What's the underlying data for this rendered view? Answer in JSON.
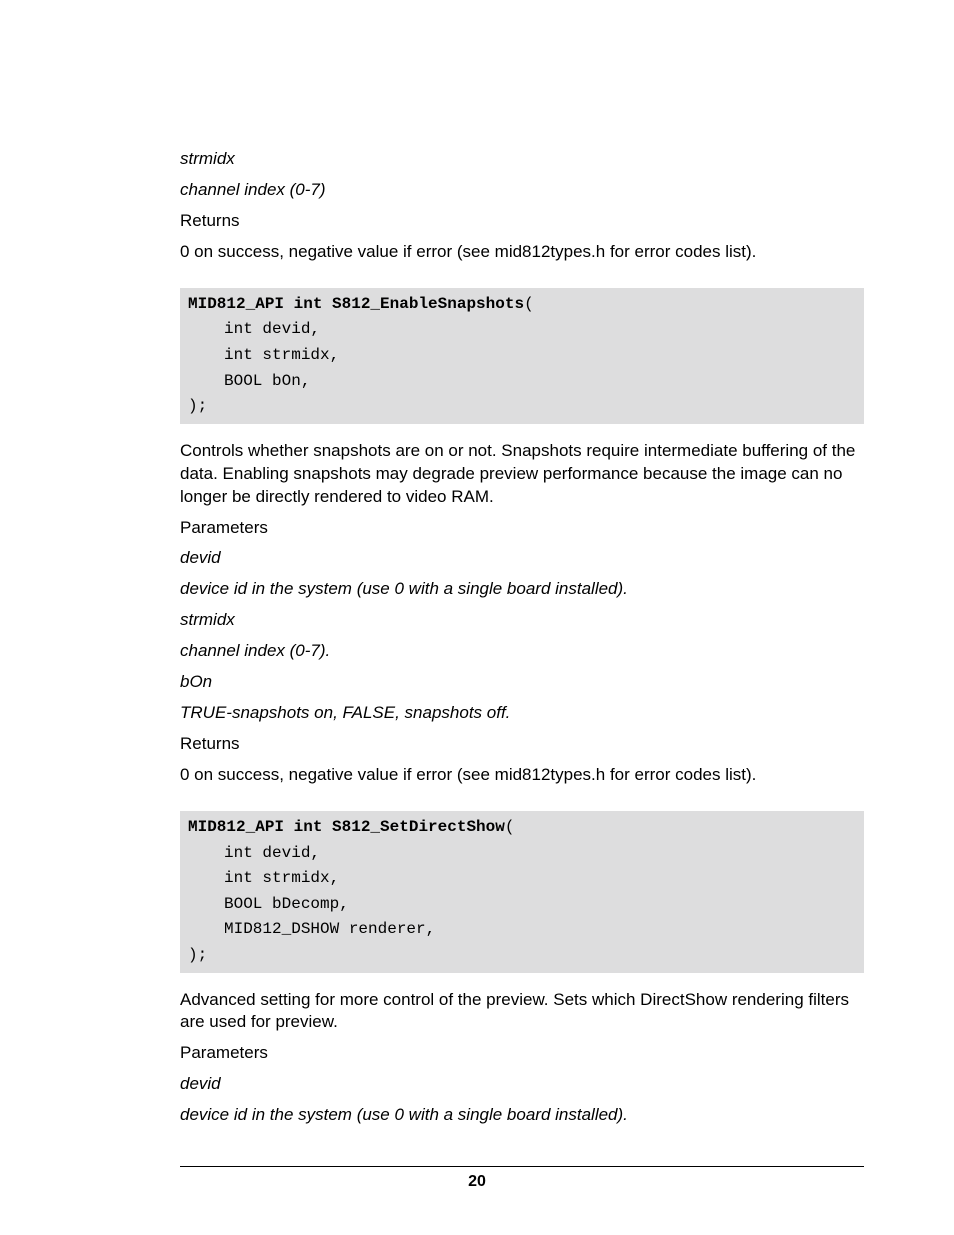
{
  "param0": {
    "name": "strmidx",
    "desc": "channel index (0-7)"
  },
  "returns_label": "Returns",
  "returns_text": "0 on success, negative value if error (see mid812types.h for error codes list).",
  "func1": {
    "sig_bold": "MID812_API int S812_EnableSnapshots",
    "sig_paren": "(",
    "lines": [
      "int devid,",
      "int strmidx,",
      "BOOL bOn,"
    ],
    "close": ");",
    "desc": "Controls whether snapshots are on or not.  Snapshots require intermediate buffering of the data.  Enabling snapshots may degrade preview performance because the image can no longer be directly rendered to video RAM.",
    "params_label": "Parameters",
    "params": [
      {
        "name": "devid",
        "desc": "device id in the system (use 0 with a single board installed)."
      },
      {
        "name": "strmidx",
        "desc": "channel index (0-7)."
      },
      {
        "name": "bOn",
        "desc": "TRUE-snapshots on, FALSE, snapshots off."
      }
    ],
    "returns_text": "0 on success, negative value if error (see mid812types.h for error codes list)."
  },
  "func2": {
    "sig_bold": "MID812_API int S812_SetDirectShow",
    "sig_paren": "(",
    "lines": [
      "int devid,",
      "int strmidx,",
      "BOOL bDecomp,",
      "MID812_DSHOW renderer,"
    ],
    "close": ");",
    "desc": "Advanced setting for more control of the preview.  Sets which DirectShow rendering filters are used for preview.",
    "params_label": "Parameters",
    "params": [
      {
        "name": "devid",
        "desc": "device id in the system (use 0 with a single board installed)."
      }
    ]
  },
  "page_number": "20"
}
